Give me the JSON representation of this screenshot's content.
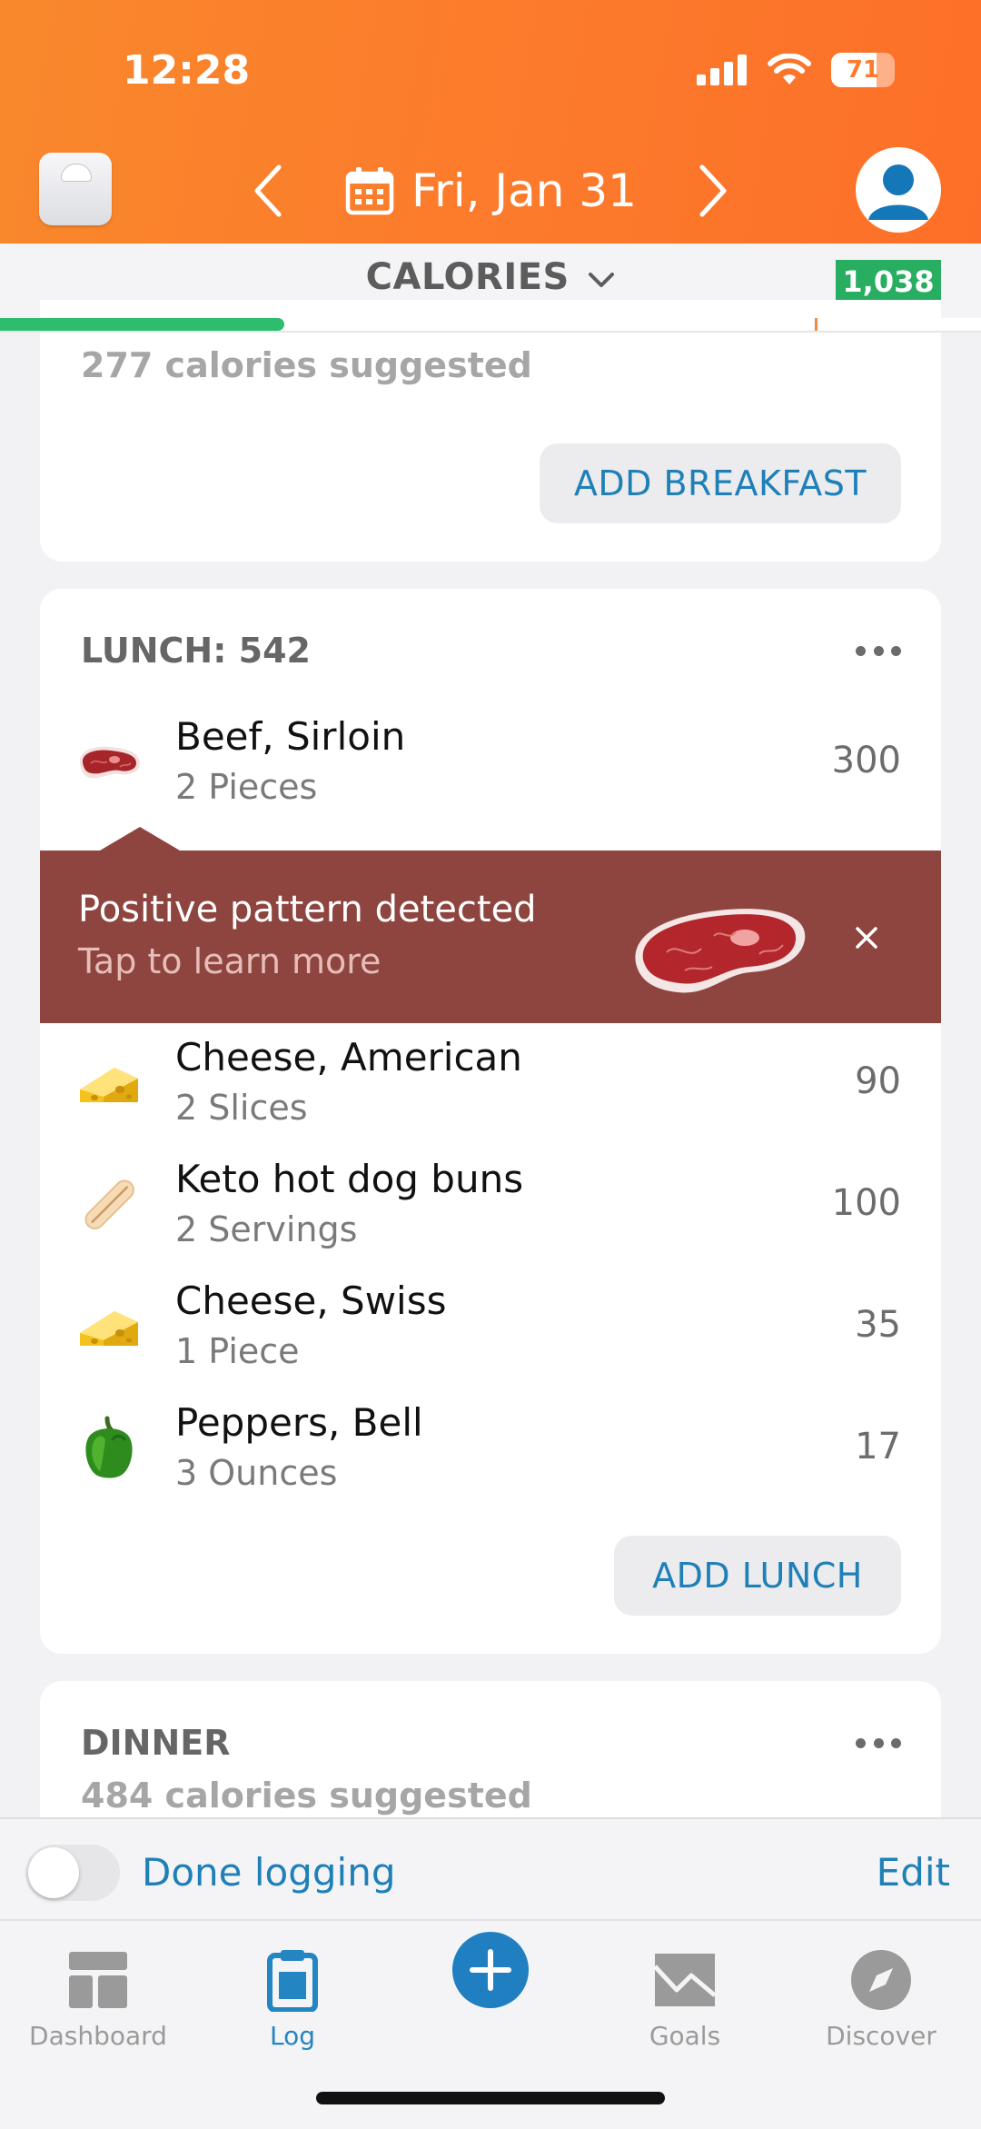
{
  "status_bar": {
    "time": "12:28",
    "battery": "71",
    "battery_level_pct": 71
  },
  "header": {
    "date": "Fri, Jan 31"
  },
  "calories_bar": {
    "label": "CALORIES",
    "remaining": "1,038",
    "progress_fraction": 0.29
  },
  "breakfast": {
    "suggested": "277 calories suggested",
    "add_label": "ADD BREAKFAST"
  },
  "lunch": {
    "title": "LUNCH: 542",
    "add_label": "ADD LUNCH",
    "items": [
      {
        "name": "Beef, Sirloin",
        "serving": "2 Pieces",
        "calories": "300",
        "icon": "steak-icon"
      },
      {
        "name": "Cheese, American",
        "serving": "2 Slices",
        "calories": "90",
        "icon": "cheese-icon"
      },
      {
        "name": "Keto hot dog buns",
        "serving": "2 Servings",
        "calories": "100",
        "icon": "hotdog-bun-icon"
      },
      {
        "name": "Cheese, Swiss",
        "serving": "1 Piece",
        "calories": "35",
        "icon": "cheese-icon"
      },
      {
        "name": "Peppers, Bell",
        "serving": "3 Ounces",
        "calories": "17",
        "icon": "bell-pepper-icon"
      }
    ]
  },
  "insight": {
    "title": "Positive pattern detected",
    "subtitle": "Tap to learn more",
    "icon": "steak-icon"
  },
  "dinner": {
    "title": "DINNER",
    "suggested": "484 calories suggested"
  },
  "done_logging": {
    "label": "Done logging",
    "edit": "Edit",
    "toggle_on": false
  },
  "tabbar": {
    "tabs": [
      {
        "label": "Dashboard",
        "icon": "dashboard-icon",
        "active": false
      },
      {
        "label": "Log",
        "icon": "clipboard-icon",
        "active": true
      },
      {
        "label": "",
        "icon": "add-icon",
        "active": false
      },
      {
        "label": "Goals",
        "icon": "goals-chart-icon",
        "active": false
      },
      {
        "label": "Discover",
        "icon": "compass-icon",
        "active": false
      }
    ]
  },
  "colors": {
    "header_orange": "#fc7a2c",
    "accent_blue": "#1f80b8",
    "progress_green": "#2ebd6e",
    "badge_green": "#27ae60",
    "insight_red": "#8e4540"
  }
}
